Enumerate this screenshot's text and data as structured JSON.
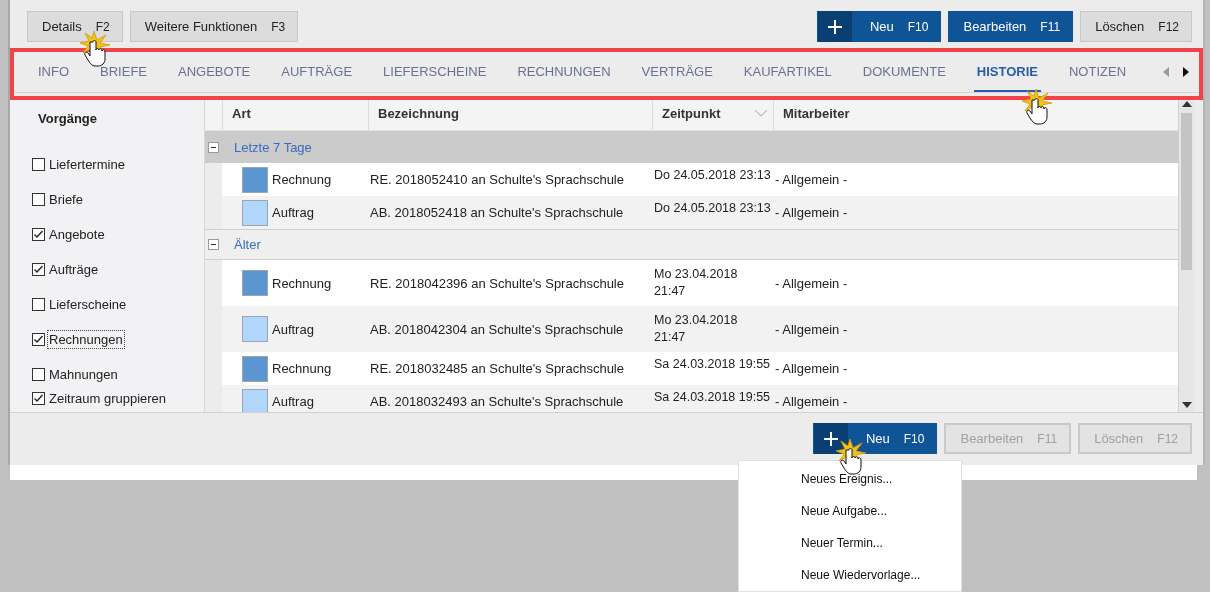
{
  "toolbar": {
    "left_buttons": [
      {
        "kind": "default",
        "label": "Details",
        "key": "F2",
        "disabled": false
      },
      {
        "kind": "default",
        "label": "Weitere Funktionen",
        "key": "F3",
        "disabled": false
      }
    ],
    "right_buttons": [
      {
        "kind": "add",
        "label": "Neu",
        "key": "F10",
        "disabled": false
      },
      {
        "kind": "primary",
        "label": "Bearbeiten",
        "key": "F11",
        "disabled": false
      },
      {
        "kind": "default",
        "label": "Löschen",
        "key": "F12",
        "disabled": false
      }
    ]
  },
  "tabs": [
    {
      "label": "INFO",
      "selected": false
    },
    {
      "label": "BRIEFE",
      "selected": false
    },
    {
      "label": "ANGEBOTE",
      "selected": false
    },
    {
      "label": "AUFTRÄGE",
      "selected": false
    },
    {
      "label": "LIEFERSCHEINE",
      "selected": false
    },
    {
      "label": "RECHNUNGEN",
      "selected": false
    },
    {
      "label": "VERTRÄGE",
      "selected": false
    },
    {
      "label": "KAUFARTIKEL",
      "selected": false
    },
    {
      "label": "DOKUMENTE",
      "selected": false
    },
    {
      "label": "HISTORIE",
      "selected": true
    },
    {
      "label": "NOTIZEN",
      "selected": false
    }
  ],
  "sidebar": {
    "title": "Vorgänge",
    "filters": [
      {
        "label": "Liefertermine",
        "checked": false,
        "focused": false
      },
      {
        "label": "Briefe",
        "checked": false,
        "focused": false
      },
      {
        "label": "Angebote",
        "checked": true,
        "focused": false
      },
      {
        "label": "Aufträge",
        "checked": true,
        "focused": false
      },
      {
        "label": "Lieferscheine",
        "checked": false,
        "focused": false
      },
      {
        "label": "Rechnungen",
        "checked": true,
        "focused": true
      },
      {
        "label": "Mahnungen",
        "checked": false,
        "focused": false
      }
    ],
    "group_option": {
      "label": "Zeitraum gruppieren",
      "checked": true
    }
  },
  "grid": {
    "columns": [
      {
        "label": "Art",
        "sorted": false
      },
      {
        "label": "Bezeichnung",
        "sorted": false
      },
      {
        "label": "Zeitpunkt",
        "sorted": true
      },
      {
        "label": "Mitarbeiter",
        "sorted": false
      }
    ],
    "groups": [
      {
        "title": "Letzte 7 Tage",
        "expanded": true,
        "selected": true,
        "rows": [
          {
            "art": "Rechnung",
            "color": "#5b96d0",
            "bezeichnung": "RE. 2018052410 an Schulte's Sprachschule",
            "zeitpunkt": "Do 24.05.2018 23:13",
            "mitarbeiter": "- Allgemein -"
          },
          {
            "art": "Auftrag",
            "color": "#b0d6fb",
            "bezeichnung": "AB. 2018052418 an Schulte's Sprachschule",
            "zeitpunkt": "Do 24.05.2018 23:13",
            "mitarbeiter": "- Allgemein -"
          }
        ]
      },
      {
        "title": "Älter",
        "expanded": true,
        "selected": false,
        "rows": [
          {
            "art": "Rechnung",
            "color": "#5b96d0",
            "bezeichnung": "RE. 2018042396 an Schulte's Sprachschule",
            "zeitpunkt": "Mo 23.04.2018\n21:47",
            "mitarbeiter": "- Allgemein -"
          },
          {
            "art": "Auftrag",
            "color": "#b0d6fb",
            "bezeichnung": "AB. 2018042304 an Schulte's Sprachschule",
            "zeitpunkt": "Mo 23.04.2018\n21:47",
            "mitarbeiter": "- Allgemein -"
          },
          {
            "art": "Rechnung",
            "color": "#5b96d0",
            "bezeichnung": "RE. 2018032485 an Schulte's Sprachschule",
            "zeitpunkt": "Sa 24.03.2018 19:55",
            "mitarbeiter": "- Allgemein -"
          },
          {
            "art": "Auftrag",
            "color": "#b0d6fb",
            "bezeichnung": "AB. 2018032493 an Schulte's Sprachschule",
            "zeitpunkt": "Sa 24.03.2018 19:55",
            "mitarbeiter": "- Allgemein -"
          }
        ]
      }
    ]
  },
  "bottom_buttons": [
    {
      "kind": "add",
      "label": "Neu",
      "key": "F10",
      "disabled": false
    },
    {
      "kind": "default",
      "label": "Bearbeiten",
      "key": "F11",
      "disabled": true
    },
    {
      "kind": "default",
      "label": "Löschen",
      "key": "F12",
      "disabled": true
    }
  ],
  "menu": {
    "items": [
      {
        "label": "Neues Ereignis..."
      },
      {
        "label": "Neue Aufgabe..."
      },
      {
        "label": "Neuer Termin..."
      },
      {
        "label": "Neue Wiedervorlage..."
      }
    ]
  }
}
